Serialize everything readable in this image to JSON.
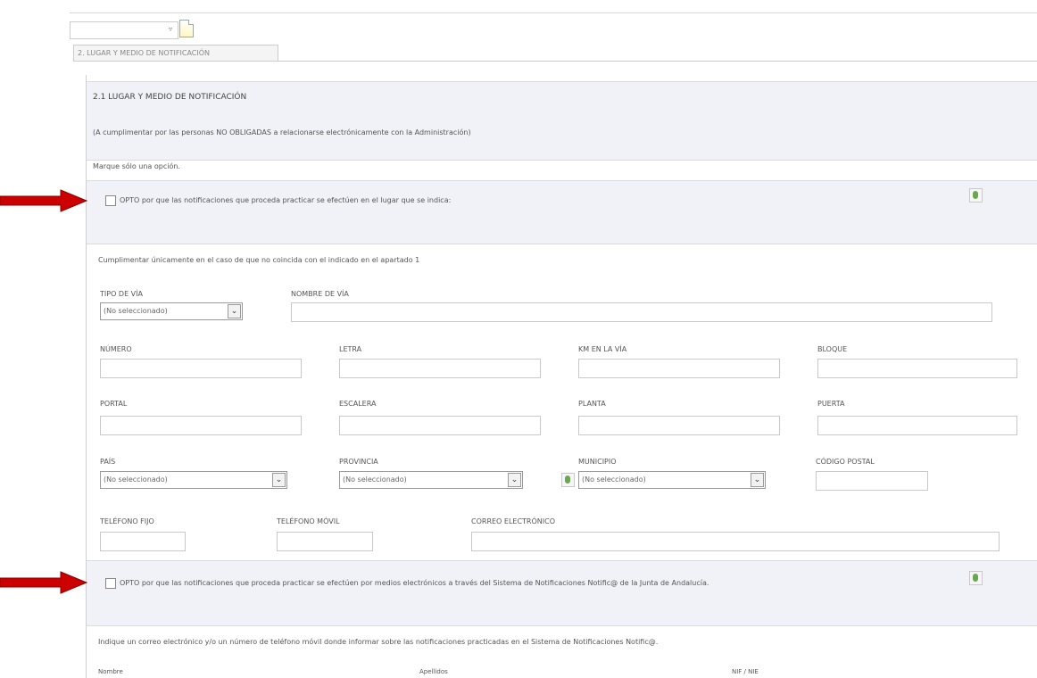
{
  "top_combo": {
    "value": "",
    "arrow": "▿"
  },
  "section_tab": "2. LUGAR Y MEDIO DE NOTIFICACIÓN",
  "section": {
    "title": "2.1 LUGAR Y MEDIO DE NOTIFICACIÓN",
    "subtitle": "(A cumplimentar por las personas NO OBLIGADAS a relacionarse electrónicamente con la Administración)",
    "mark_one": "Marque sólo una opción."
  },
  "option1": {
    "label": "OPTO por que las notificaciones que proceda practicar se efectúen en el lugar que se indica:",
    "checked": false
  },
  "complete_note": "Cumplimentar únicamente en el caso de que no coincida con el indicado en el apartado 1",
  "fields": {
    "tipo_via": {
      "label": "TIPO DE VÍA",
      "value": "(No seleccionado)"
    },
    "nombre_via": {
      "label": "NOMBRE DE VÍA",
      "value": ""
    },
    "numero": {
      "label": "NÚMERO",
      "value": ""
    },
    "letra": {
      "label": "LETRA",
      "value": ""
    },
    "km": {
      "label": "KM EN LA VÍA",
      "value": ""
    },
    "bloque": {
      "label": "BLOQUE",
      "value": ""
    },
    "portal": {
      "label": "PORTAL",
      "value": ""
    },
    "escalera": {
      "label": "ESCALERA",
      "value": ""
    },
    "planta": {
      "label": "PLANTA",
      "value": ""
    },
    "puerta": {
      "label": "PUERTA",
      "value": ""
    },
    "pais": {
      "label": "PAÍS",
      "value": "(No seleccionado)"
    },
    "provincia": {
      "label": "PROVINCIA",
      "value": "(No seleccionado)"
    },
    "municipio": {
      "label": "MUNICIPIO",
      "value": "(No seleccionado)"
    },
    "codigo_postal": {
      "label": "CÓDIGO POSTAL",
      "value": ""
    },
    "telefono_fijo": {
      "label": "TELÉFONO FIJO",
      "value": ""
    },
    "telefono_movil": {
      "label": "TELÉFONO MÓVIL",
      "value": ""
    },
    "correo": {
      "label": "CORREO ELECTRÓNICO",
      "value": ""
    }
  },
  "dropdown_glyph": "⌄",
  "option2": {
    "label": "OPTO por que las notificaciones que proceda practicar se efectúen por medios electrónicos a través del Sistema de Notificaciones Notific@ de la Junta de Andalucía.",
    "checked": false
  },
  "indicate_note": "Indique un correo electrónico y/o un número de teléfono móvil donde informar sobre las notificaciones practicadas en el Sistema de Notificaciones Notific@.",
  "bottom_labels": {
    "nombre": "Nombre",
    "apellidos": "Apellidos",
    "nif": "NIF / NIE"
  },
  "colors": {
    "arrow": "#cc0000",
    "panel": "#f0f2f7",
    "action_green": "#6aa84f"
  }
}
